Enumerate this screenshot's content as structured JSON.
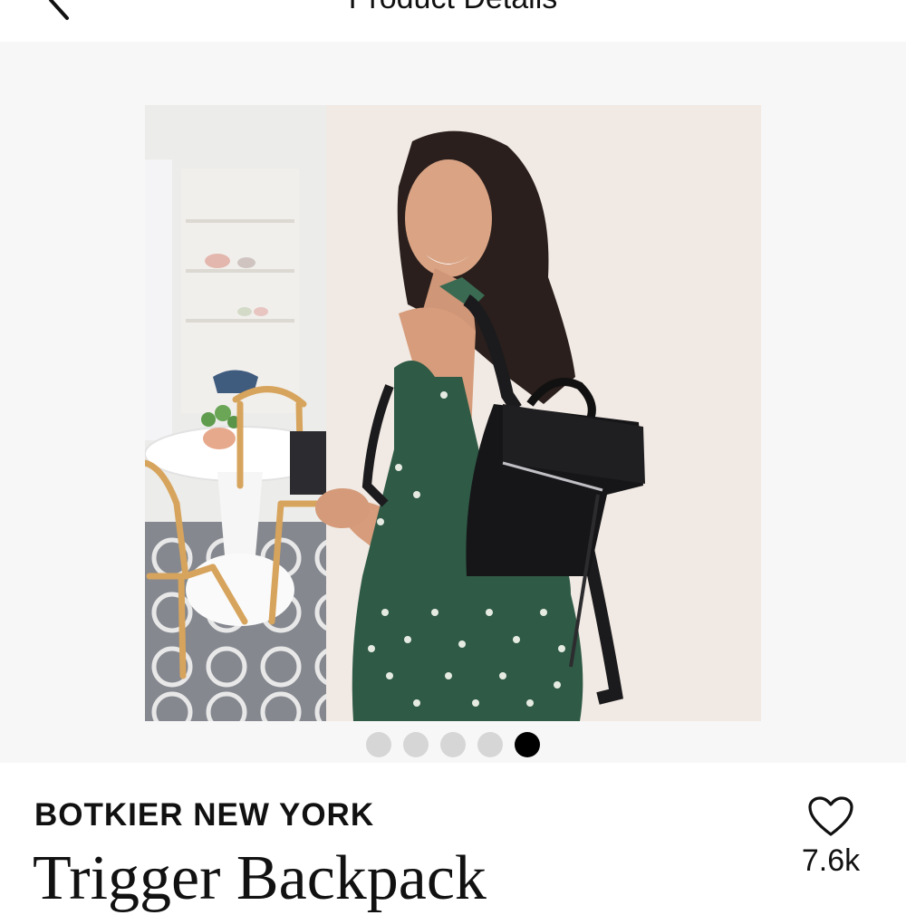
{
  "header": {
    "title": "Product Details",
    "back_icon": "chevron-left-icon"
  },
  "gallery": {
    "image_count": 5,
    "active_index": 4,
    "image_subject": "woman wearing a black backpack in a dining room"
  },
  "product": {
    "brand": "BOTKIER NEW YORK",
    "name": "Trigger Backpack",
    "likes": "7.6k",
    "like_icon": "heart-icon"
  },
  "colors": {
    "gallery_bg": "#f7f7f7",
    "active_dot": "#000000",
    "inactive_dot": "#d6d6d6",
    "text": "#111111"
  }
}
